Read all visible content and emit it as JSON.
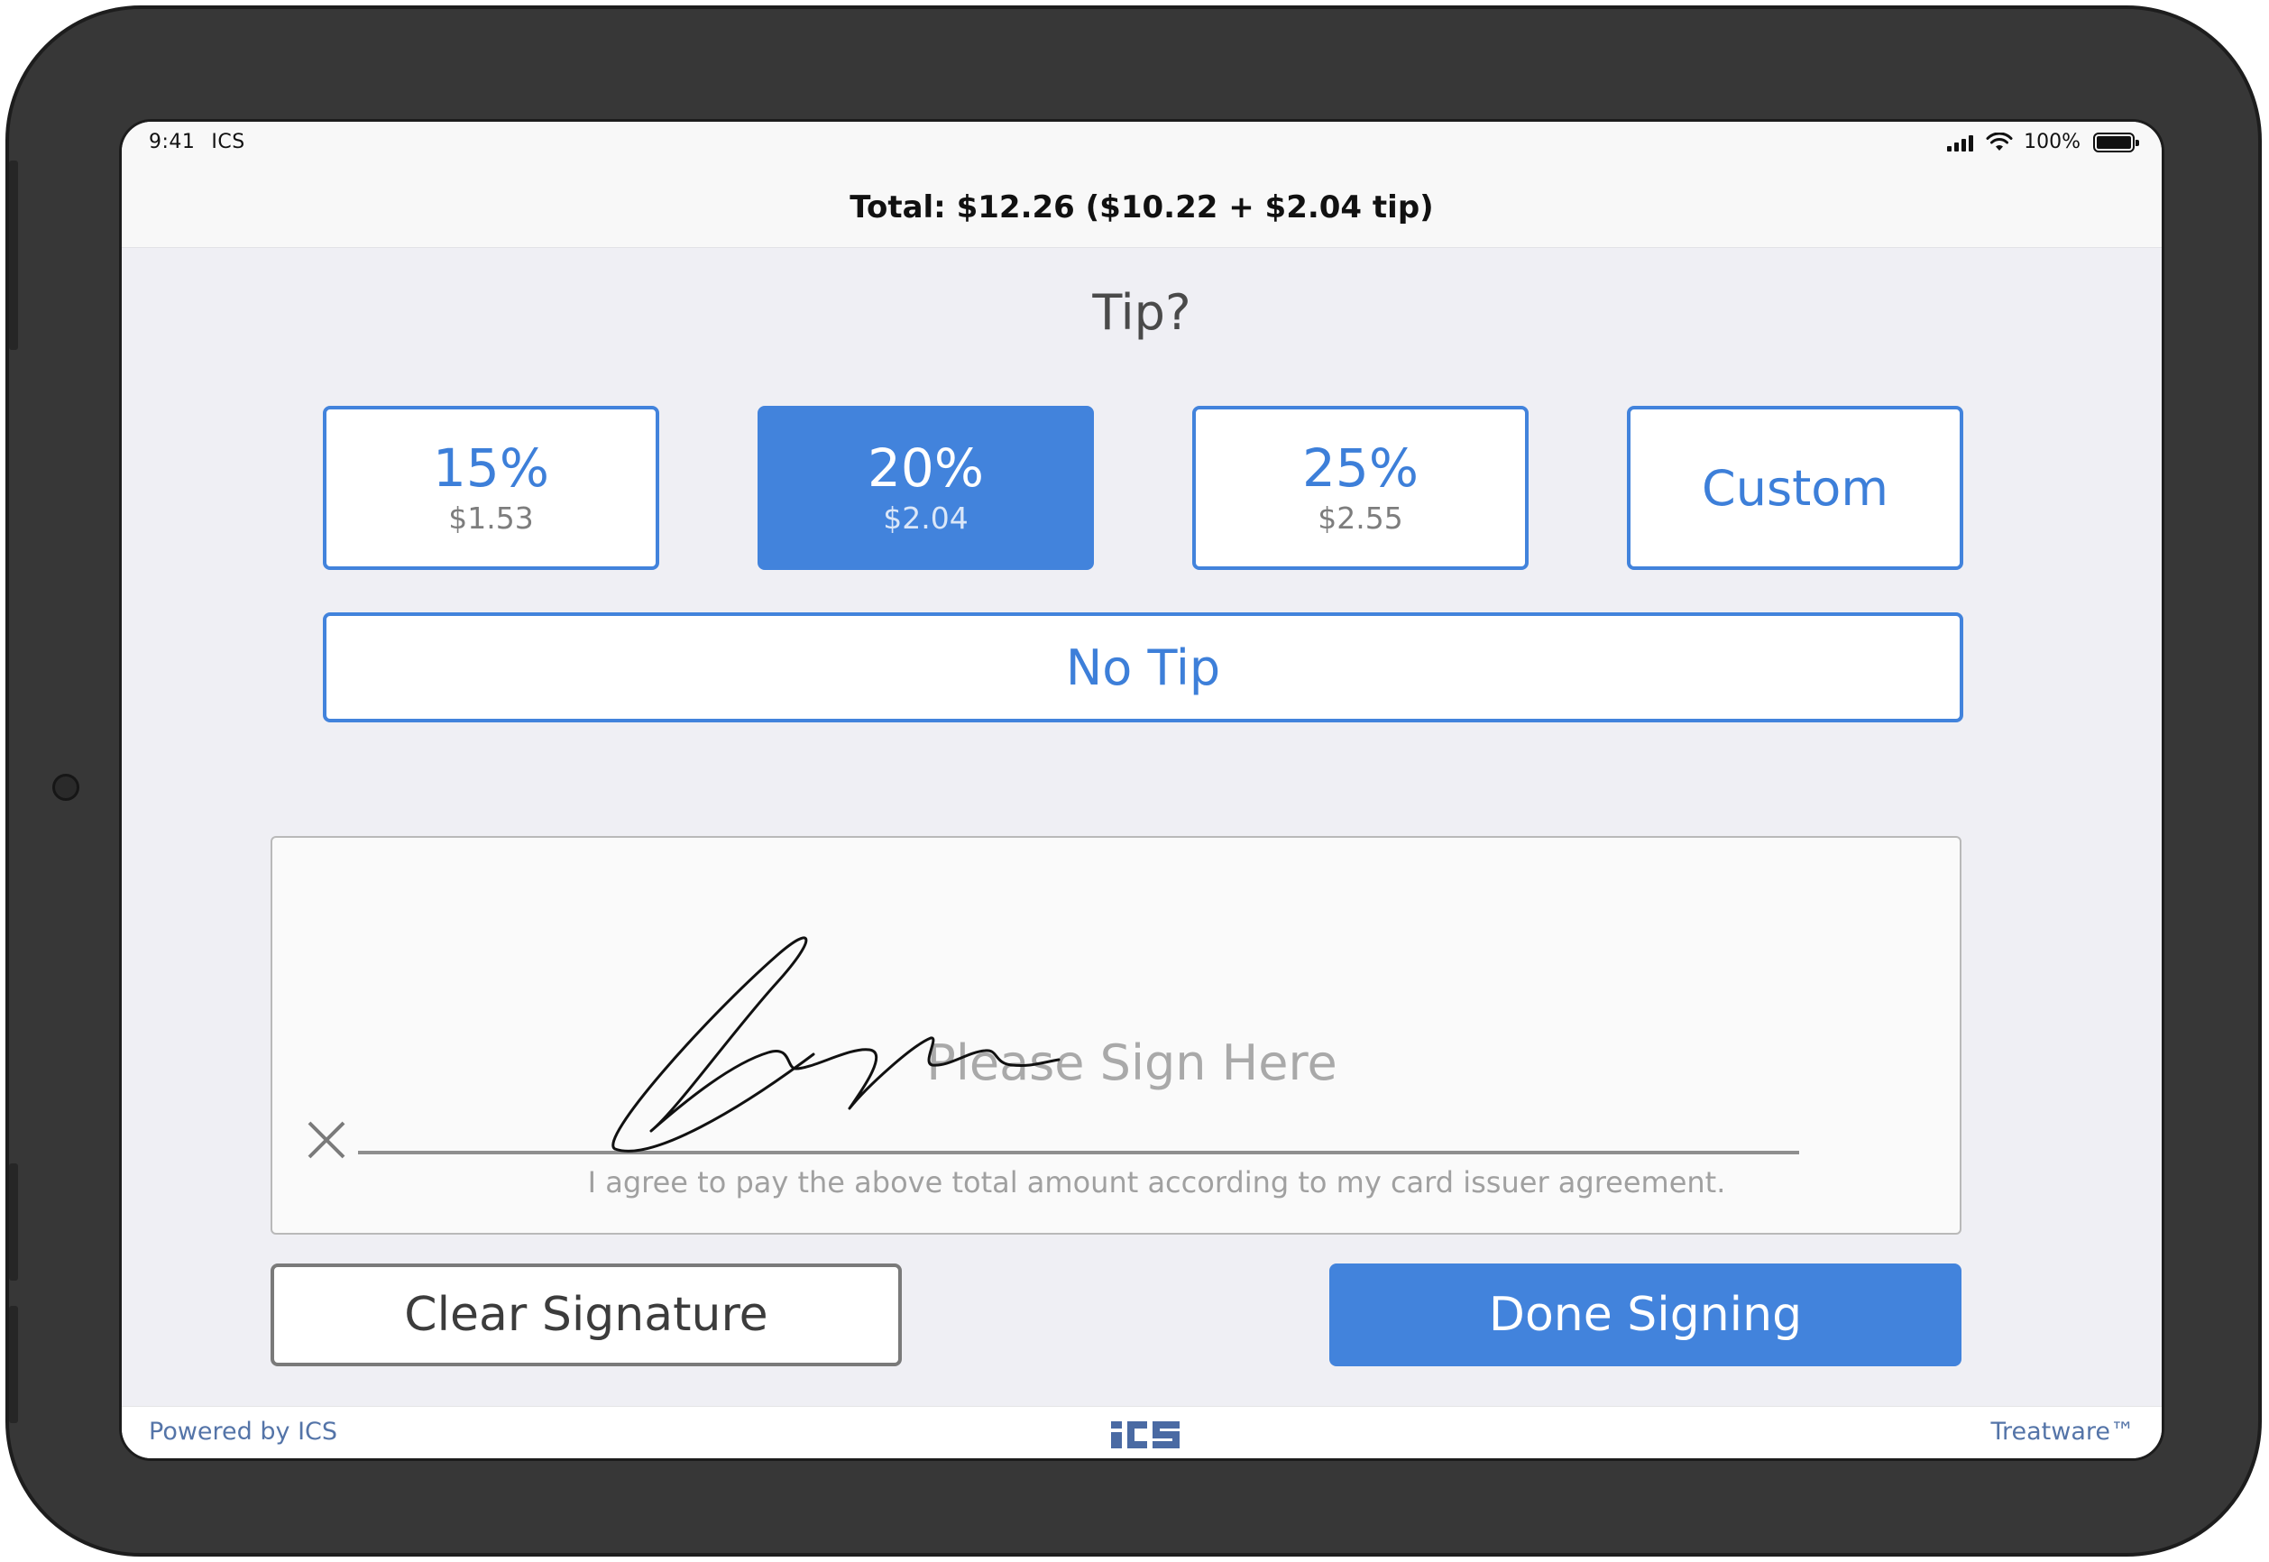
{
  "status_bar": {
    "time": "9:41",
    "carrier": "ICS",
    "battery_label": "100%",
    "battery_level": 1.0
  },
  "header": {
    "total_text": "Total: $12.26 ($10.22 + $2.04 tip)"
  },
  "tip": {
    "title": "Tip?",
    "options": [
      {
        "percent": "15%",
        "amount": "$1.53",
        "selected": false
      },
      {
        "percent": "20%",
        "amount": "$2.04",
        "selected": true
      },
      {
        "percent": "25%",
        "amount": "$2.55",
        "selected": false
      }
    ],
    "custom_label": "Custom",
    "no_tip_label": "No Tip"
  },
  "signature": {
    "placeholder": "Please Sign Here",
    "agreement": "I agree to pay the above total amount according to my card issuer agreement."
  },
  "actions": {
    "clear_label": "Clear Signature",
    "done_label": "Done Signing"
  },
  "footer": {
    "powered_by": "Powered by ICS",
    "brand": "Treatware™",
    "logo_text": "ICS"
  },
  "colors": {
    "accent": "#4283dc",
    "frame": "#373737",
    "background": "#efeff4"
  },
  "icons": {
    "signal": "cellular-signal-icon",
    "wifi": "wifi-icon",
    "battery": "battery-icon",
    "clear_x": "close-icon",
    "logo": "ics-logo-icon"
  }
}
